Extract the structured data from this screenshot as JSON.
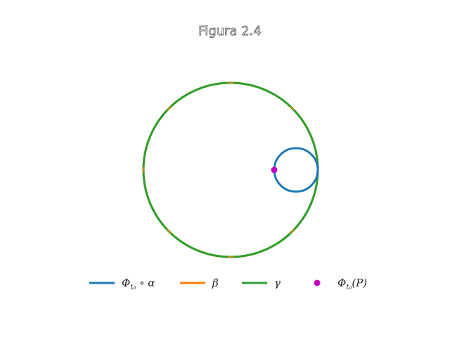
{
  "figure": {
    "title": "Figura 2.4"
  },
  "legend": {
    "items": [
      {
        "key": "alpha",
        "color": "#1f77b4",
        "marker": "line",
        "label_main": "Φ",
        "label_sub": "t₀",
        "label_rest": " ∘ α"
      },
      {
        "key": "beta",
        "color": "#ff7f0e",
        "marker": "line",
        "label_main": "β",
        "label_sub": "",
        "label_rest": ""
      },
      {
        "key": "gamma",
        "color": "#2ca02c",
        "marker": "line",
        "label_main": "γ",
        "label_sub": "",
        "label_rest": ""
      },
      {
        "key": "point",
        "color": "#c000c0",
        "marker": "dot",
        "label_main": "Φ",
        "label_sub": "t₀",
        "label_rest": "(P)"
      }
    ]
  },
  "diagram": {
    "boundary_circle": {
      "color": "#ff7f0e",
      "tick_angles_deg": [
        0,
        90,
        180,
        270,
        45,
        135,
        225,
        315
      ]
    },
    "geodesic_square": {
      "color": "#2ca02c",
      "vertex_angles_deg": [
        45,
        135,
        225,
        315
      ]
    },
    "horocycle": {
      "color": "#1f77b4",
      "tangent_angle_deg": 0,
      "radius_fraction": 0.25
    },
    "point_P": {
      "color": "#c000c0",
      "on_horocycle_angle_deg": 180
    }
  }
}
